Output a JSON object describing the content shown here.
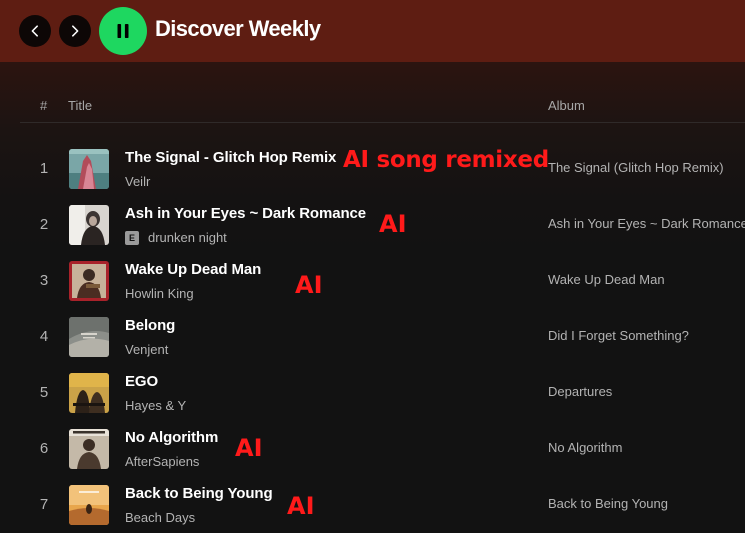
{
  "header": {
    "playlist_title": "Discover Weekly"
  },
  "columns": {
    "number": "#",
    "title": "Title",
    "album": "Album"
  },
  "tracks": [
    {
      "number": "1",
      "title": "The Signal - Glitch Hop Remix",
      "artist": "Veilr",
      "explicit": false,
      "album": "The Signal (Glitch Hop Remix)",
      "annotation": "AI song remixed"
    },
    {
      "number": "2",
      "title": "Ash in Your Eyes ~ Dark Romance",
      "artist": "drunken night",
      "explicit": true,
      "explicit_label": "E",
      "album": "Ash in Your Eyes ~ Dark Romance",
      "annotation": "AI"
    },
    {
      "number": "3",
      "title": "Wake Up Dead Man",
      "artist": "Howlin King",
      "explicit": false,
      "album": "Wake Up Dead Man",
      "annotation": "AI"
    },
    {
      "number": "4",
      "title": "Belong",
      "artist": "Venjent",
      "explicit": false,
      "album": "Did I Forget Something?",
      "annotation": ""
    },
    {
      "number": "5",
      "title": "EGO",
      "artist": "Hayes & Y",
      "explicit": false,
      "album": "Departures",
      "annotation": ""
    },
    {
      "number": "6",
      "title": "No Algorithm",
      "artist": "AfterSapiens",
      "explicit": false,
      "album": "No Algorithm",
      "annotation": "AI"
    },
    {
      "number": "7",
      "title": "Back to Being Young",
      "artist": "Beach Days",
      "explicit": false,
      "album": "Back to Being Young",
      "annotation": "AI"
    }
  ],
  "colors": {
    "header_bg": "#5e1d12",
    "play_green": "#1ed760",
    "annotation_red": "#ff1a1a",
    "muted_text": "#b3b3b3"
  },
  "icons": {
    "back": "chevron-left-icon",
    "forward": "chevron-right-icon",
    "play_state": "pause-icon"
  }
}
